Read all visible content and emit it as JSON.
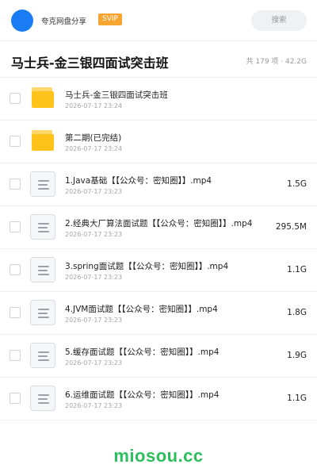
{
  "header": {
    "share_name": "夸克网盘分享",
    "svip_label": "SVIP",
    "search_placeholder": "搜索"
  },
  "share": {
    "title": "马士兵-金三银四面试突击班",
    "meta": "共 179 项 · 42.2G"
  },
  "files": [
    {
      "type": "folder-icon",
      "name": "马士兵-金三银四面试突击班",
      "date": "2026-07-17 23:24",
      "size": ""
    },
    {
      "type": "folder-icon",
      "name": "第二期(已完结)",
      "date": "2026-07-17 23:24",
      "size": ""
    },
    {
      "type": "video-file-icon",
      "name": "1.Java基础【【公众号：密知圈】】.mp4",
      "date": "2026-07-17 23:23",
      "size": "1.5G"
    },
    {
      "type": "video-file-icon",
      "name": "2.经典大厂算法面试题【【公众号：密知圈】】.mp4",
      "date": "2026-07-17 23:23",
      "size": "295.5M"
    },
    {
      "type": "video-file-icon",
      "name": "3.spring面试题【【公众号：密知圈】】.mp4",
      "date": "2026-07-17 23:23",
      "size": "1.1G"
    },
    {
      "type": "video-file-icon",
      "name": "4.JVM面试题【【公众号：密知圈】】.mp4",
      "date": "2026-07-17 23:23",
      "size": "1.8G"
    },
    {
      "type": "video-file-icon",
      "name": "5.缓存面试题【【公众号：密知圈】】.mp4",
      "date": "2026-07-17 23:23",
      "size": "1.9G"
    },
    {
      "type": "video-file-icon",
      "name": "6.运维面试题【【公众号：密知圈】】.mp4",
      "date": "2026-07-17 23:23",
      "size": "1.1G"
    }
  ],
  "watermark": "miosou.cc",
  "colors": {
    "accent": "#1a7cf5",
    "svip": "#f7a531",
    "folder": "#ffc21a",
    "watermark": "#2cbe5c"
  }
}
